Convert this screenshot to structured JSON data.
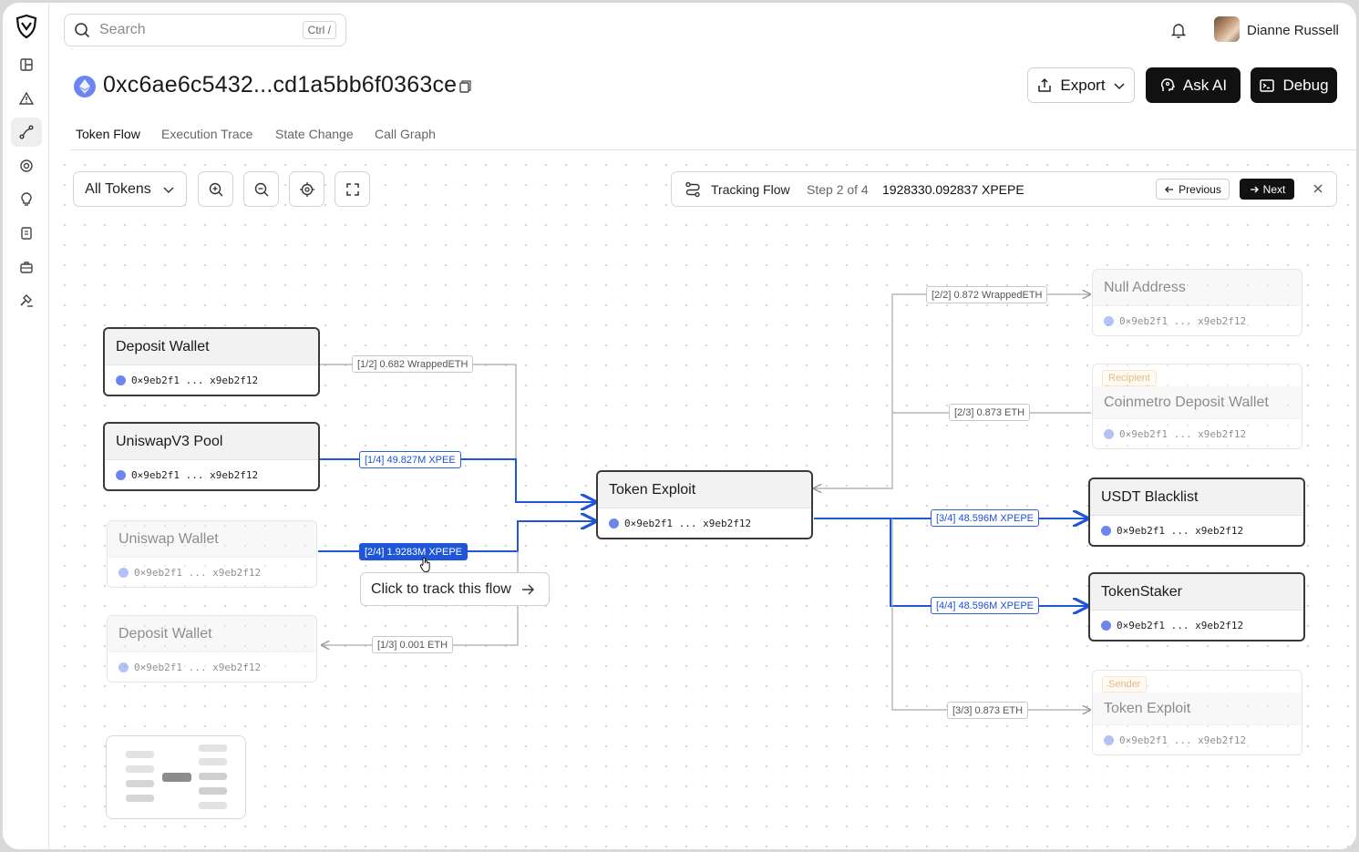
{
  "app": {
    "user_name": "Dianne Russell"
  },
  "search": {
    "placeholder": "Search",
    "shortcut": "Ctrl /"
  },
  "header": {
    "title": "0xc6ae6c5432...cd1a5bb6f0363ce",
    "export_label": "Export",
    "ask_ai_label": "Ask AI",
    "debug_label": "Debug"
  },
  "tabs": [
    "Token Flow",
    "Execution Trace",
    "State Change",
    "Call Graph"
  ],
  "toolbar": {
    "token_filter": "All Tokens"
  },
  "tracking": {
    "label": "Tracking Flow",
    "step": "Step 2 of 4",
    "amount": "1928330.092837 XPEPE",
    "prev_label": "Previous",
    "next_label": "Next"
  },
  "nodes": {
    "deposit_wallet_1": {
      "name": "Deposit Wallet",
      "address": "0×9eb2f1 ... x9eb2f12"
    },
    "uniswapv3_pool": {
      "name": "UniswapV3 Pool",
      "address": "0×9eb2f1 ... x9eb2f12"
    },
    "uniswap_wallet": {
      "name": "Uniswap Wallet",
      "address": "0×9eb2f1 ... x9eb2f12"
    },
    "deposit_wallet_2": {
      "name": "Deposit Wallet",
      "address": "0×9eb2f1 ... x9eb2f12"
    },
    "token_exploit_center": {
      "name": "Token Exploit",
      "address": "0×9eb2f1 ... x9eb2f12"
    },
    "null_address": {
      "name": "Null Address",
      "address": "0×9eb2f1 ... x9eb2f12"
    },
    "coinmetro": {
      "tag": "Recipient",
      "name": "Coinmetro Deposit Wallet",
      "address": "0×9eb2f1 ... x9eb2f12"
    },
    "usdt_blacklist": {
      "name": "USDT Blacklist",
      "address": "0×9eb2f1 ... x9eb2f12"
    },
    "tokenstaker": {
      "name": "TokenStaker",
      "address": "0×9eb2f1 ... x9eb2f12"
    },
    "token_exploit_sender": {
      "tag": "Sender",
      "name": "Token Exploit",
      "address": "0×9eb2f1 ... x9eb2f12"
    }
  },
  "edges": {
    "e1": "[1/2] 0.682 WrappedETH",
    "e2": "[1/4] 49.827M XPEE",
    "e3": "[2/4] 1.9283M XPEPE",
    "e4": "[1/3] 0.001 ETH",
    "e5": "[2/2] 0.872 WrappedETH",
    "e6": "[2/3] 0.873 ETH",
    "e7": "[3/4] 48.596M XPEPE",
    "e8": "[4/4] 48.596M XPEPE",
    "e9": "[3/3] 0.873 ETH"
  },
  "tooltip": {
    "text": "Click to track this flow"
  },
  "colors": {
    "flow_blue": "#1f56d8",
    "accent_dark": "#111111",
    "eth_blue": "#6b86ee",
    "tag_orange": "#c97900"
  }
}
